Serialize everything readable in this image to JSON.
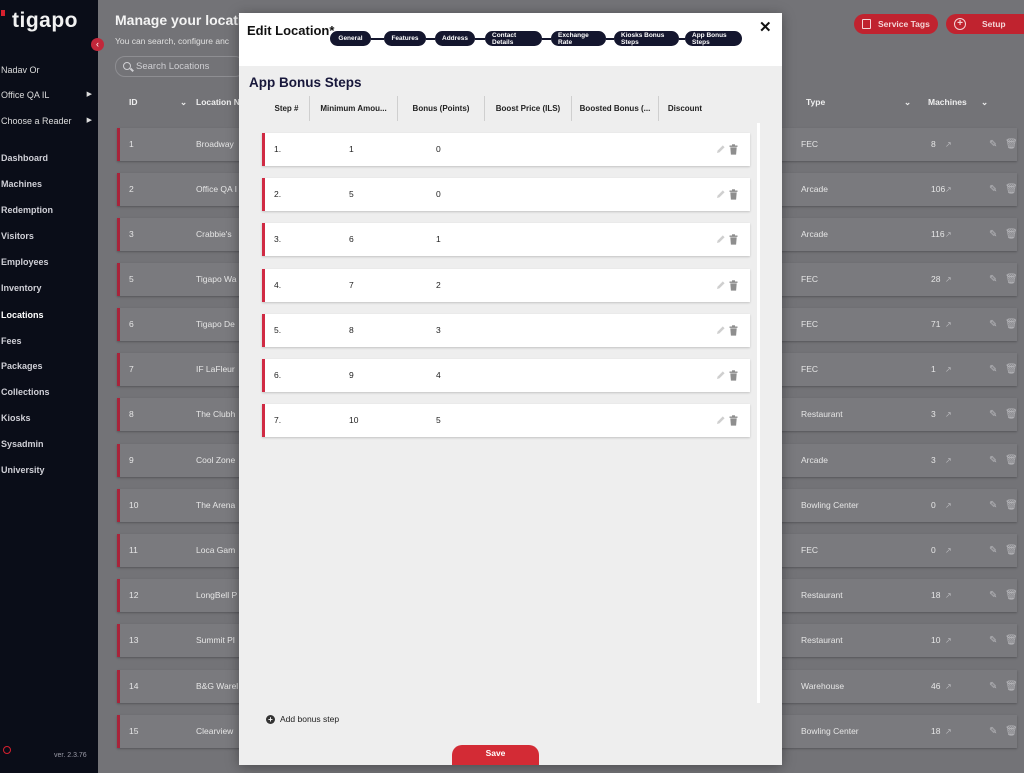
{
  "sidebar": {
    "logo": "tigapo",
    "user": "Nadav Or",
    "org": "Office QA IL",
    "reader": "Choose a Reader",
    "nav": [
      "Dashboard",
      "Machines",
      "Redemption",
      "Visitors",
      "Employees",
      "Inventory",
      "Locations",
      "Fees",
      "Packages",
      "Collections",
      "Kiosks",
      "Sysadmin",
      "University"
    ],
    "active": "Locations",
    "version": "ver. 2.3.76"
  },
  "page": {
    "title": "Manage your locati",
    "subtitle": "You can search, configure anc",
    "search_placeholder": "Search Locations",
    "service_tags_label": "Service Tags",
    "setup_label": "Setup",
    "columns": {
      "id": "ID",
      "location": "Location N",
      "type": "Type",
      "machines": "Machines"
    },
    "rows": [
      {
        "id": "1",
        "name": "Broadway",
        "type": "FEC",
        "machines": "8"
      },
      {
        "id": "2",
        "name": "Office QA I",
        "type": "Arcade",
        "machines": "106"
      },
      {
        "id": "3",
        "name": "Crabbie's",
        "type": "Arcade",
        "machines": "116"
      },
      {
        "id": "5",
        "name": "Tigapo Wa",
        "type": "FEC",
        "machines": "28"
      },
      {
        "id": "6",
        "name": "Tigapo De",
        "type": "FEC",
        "machines": "71"
      },
      {
        "id": "7",
        "name": "IF LaFleur",
        "type": "FEC",
        "machines": "1"
      },
      {
        "id": "8",
        "name": "The Clubh",
        "type": "Restaurant",
        "machines": "3"
      },
      {
        "id": "9",
        "name": "Cool Zone",
        "type": "Arcade",
        "machines": "3"
      },
      {
        "id": "10",
        "name": "The Arena",
        "type": "Bowling Center",
        "machines": "0"
      },
      {
        "id": "11",
        "name": "Loca Gam",
        "type": "FEC",
        "machines": "0"
      },
      {
        "id": "12",
        "name": "LongBell P",
        "type": "Restaurant",
        "machines": "18"
      },
      {
        "id": "13",
        "name": "Summit Pl",
        "type": "Restaurant",
        "machines": "10"
      },
      {
        "id": "14",
        "name": "B&G Warel",
        "type": "Warehouse",
        "machines": "46"
      },
      {
        "id": "15",
        "name": "Clearview",
        "type": "Bowling Center",
        "machines": "18"
      }
    ]
  },
  "modal": {
    "title": "Edit Location*",
    "steps": [
      "General",
      "Features",
      "Address",
      "Contact Details",
      "Exchange Rate",
      "Kiosks Bonus Steps",
      "App Bonus Steps"
    ],
    "section_title": "App Bonus Steps",
    "headers": [
      "Step #",
      "Minimum Amou...",
      "Bonus (Points)",
      "Boost Price (ILS)",
      "Boosted Bonus (...",
      "Discount"
    ],
    "rows": [
      {
        "step": "1.",
        "min": "1",
        "bonus": "0"
      },
      {
        "step": "2.",
        "min": "5",
        "bonus": "0"
      },
      {
        "step": "3.",
        "min": "6",
        "bonus": "1"
      },
      {
        "step": "4.",
        "min": "7",
        "bonus": "2"
      },
      {
        "step": "5.",
        "min": "8",
        "bonus": "3"
      },
      {
        "step": "6.",
        "min": "9",
        "bonus": "4"
      },
      {
        "step": "7.",
        "min": "10",
        "bonus": "5"
      }
    ],
    "add_label": "Add bonus step",
    "save_label": "Save",
    "close_symbol": "✕"
  },
  "colors": {
    "accent": "#d02a43",
    "pill": "#14162e",
    "sidebar": "#0a0d18"
  }
}
